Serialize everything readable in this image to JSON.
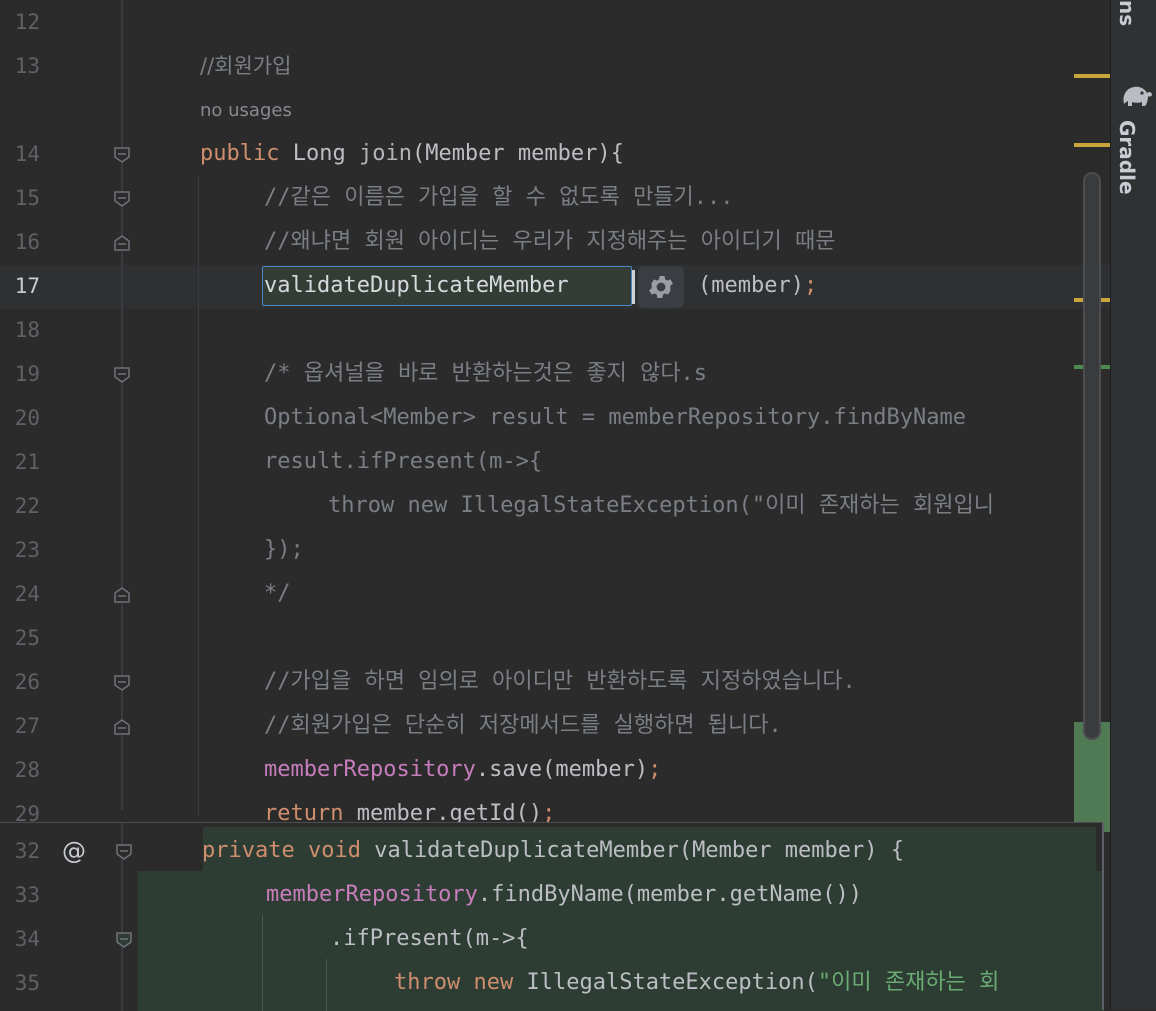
{
  "editor": {
    "usage_hint": "no usages",
    "lines": [
      {
        "num": "12"
      },
      {
        "num": "13"
      },
      {
        "num": "14"
      },
      {
        "num": "15"
      },
      {
        "num": "16"
      },
      {
        "num": "17"
      },
      {
        "num": "18"
      },
      {
        "num": "19"
      },
      {
        "num": "20"
      },
      {
        "num": "21"
      },
      {
        "num": "22"
      },
      {
        "num": "23"
      },
      {
        "num": "24"
      },
      {
        "num": "25"
      },
      {
        "num": "26"
      },
      {
        "num": "27"
      },
      {
        "num": "28"
      },
      {
        "num": "29"
      }
    ],
    "code": {
      "l13": "//회원가입",
      "l14_kw": "public",
      "l14_type": "Long",
      "l14_fn": "join",
      "l14_rest": "(Member member){",
      "l15": "//같은 이름은 가입을 할 수 없도록 만들기...",
      "l16": "//왜냐면 회원 아이디는 우리가 지정해주는 아이디기 때문",
      "l17_ident": "validateDuplicateMember",
      "l17_rest": "(member)",
      "l17_semi": ";",
      "l19": "/* 옵셔널을 바로 반환하는것은 좋지 않다.s",
      "l20": "Optional<Member> result = memberRepository.findByName",
      "l21": "result.ifPresent(m->{",
      "l22": "throw new IllegalStateException(\"이미 존재하는 회원입니",
      "l23": "});",
      "l24": "*/",
      "l26": "//가입을 하면 임의로 아이디만 반환하도록 지정하였습니다.",
      "l27": "//회원가입은 단순히 저장메서드를 실행하면 됩니다.",
      "l28_field": "memberRepository",
      "l28_rest": ".save(member)",
      "l28_semi": ";",
      "l29_kw": "return",
      "l29_rest": " member.getId()",
      "l29_semi": ";"
    }
  },
  "peek": {
    "lines": [
      {
        "num": "32"
      },
      {
        "num": "33"
      },
      {
        "num": "34"
      },
      {
        "num": "35"
      }
    ],
    "override_marker": "@",
    "l32_kw1": "private",
    "l32_kw2": "void",
    "l32_rest": "validateDuplicateMember(Member member) {",
    "l33_field": "memberRepository",
    "l33_rest": ".findByName(member.getName())",
    "l34": ".ifPresent(m->{",
    "l35_kw1": "throw",
    "l35_kw2": "new",
    "l35_rest": "IllegalStateException(",
    "l35_str": "\"이미 존재하는 회"
  },
  "toolstrip": {
    "top_label": "ns",
    "gradle_label": "Gradle"
  },
  "icons": [
    "settings-gear-icon",
    "gradle-elephant-icon",
    "fold-marker-icon",
    "override-icon"
  ],
  "colors": {
    "background": "#2b2b2b",
    "keyword": "#cf8e6d",
    "comment": "#7a7e85",
    "field": "#c77dbb",
    "string": "#6aab73",
    "selection_border": "#4a88c7",
    "diff_added": "#2e3d33"
  }
}
